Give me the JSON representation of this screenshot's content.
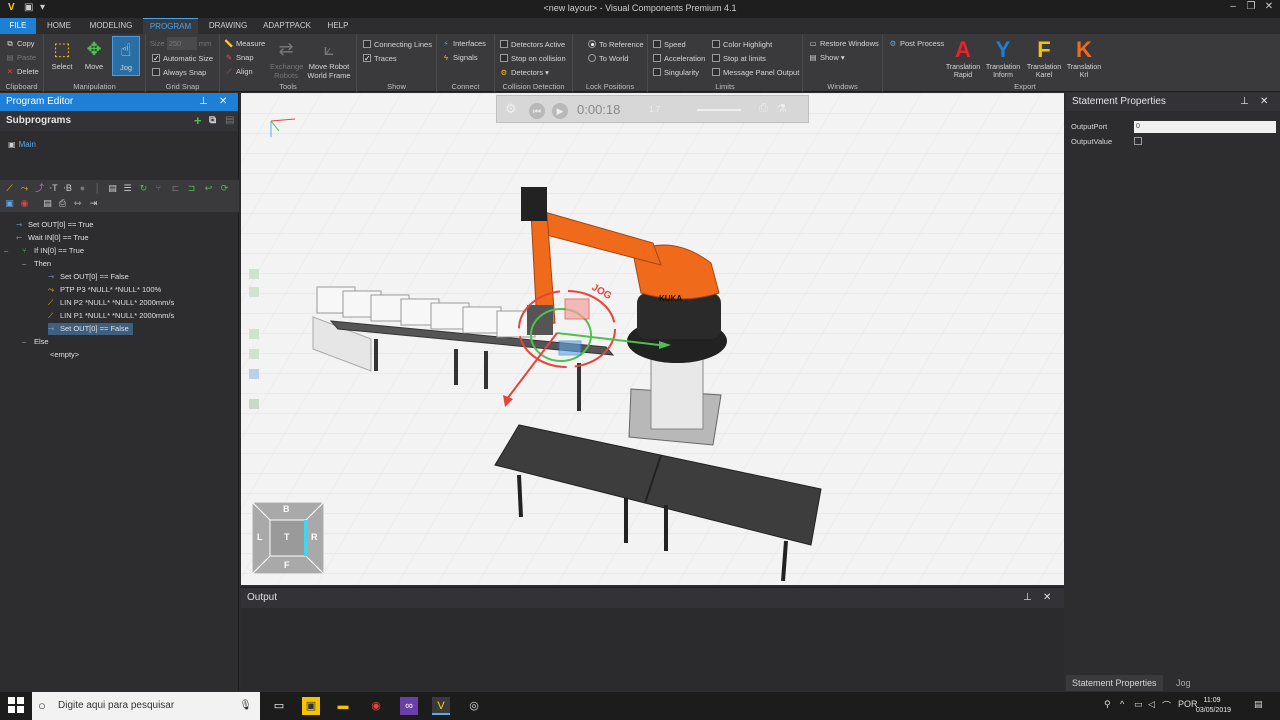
{
  "window": {
    "title": "<new layout> - Visual Components Premium 4.1"
  },
  "ribbon_tabs": [
    "FILE",
    "HOME",
    "MODELING",
    "PROGRAM",
    "DRAWING",
    "ADAPTPACK",
    "HELP"
  ],
  "clipboard": {
    "copy": "Copy",
    "paste": "Paste",
    "delete": "Delete",
    "label": "Clipboard"
  },
  "manipulation": {
    "select": "Select",
    "move": "Move",
    "jog": "Jog",
    "label": "Manipulation"
  },
  "grid_snap": {
    "size_label": "Size",
    "size_value": "250",
    "size_unit": "mm",
    "automatic_size": "Automatic Size",
    "always_snap": "Always Snap",
    "label": "Grid Snap"
  },
  "tools": {
    "measure": "Measure",
    "snap": "Snap",
    "align": "Align",
    "exchange": "Exchange Robots",
    "move_robot": "Move Robot World Frame",
    "label": "Tools"
  },
  "show": {
    "connecting_lines": "Connecting Lines",
    "traces": "Traces",
    "label": "Show"
  },
  "connect": {
    "interfaces": "Interfaces",
    "signals": "Signals",
    "label": "Connect"
  },
  "collision": {
    "detectors_active": "Detectors Active",
    "stop_on_collision": "Stop on collision",
    "detectors": "Detectors ▾",
    "label": "Collision Detection"
  },
  "lock": {
    "to_reference": "To Reference",
    "to_world": "To World",
    "label": "Lock Positions"
  },
  "limits": {
    "speed": "Speed",
    "acceleration": "Acceleration",
    "singularity": "Singularity",
    "color_highlight": "Color Highlight",
    "stop_at_limits": "Stop at limits",
    "message_panel": "Message Panel Output",
    "label": "Limits"
  },
  "windows": {
    "restore": "Restore Windows",
    "show": "Show ▾",
    "post_process": "Post Process",
    "label": "Windows"
  },
  "export": {
    "label": "Export",
    "items": [
      {
        "letter": "A",
        "line1": "Translation",
        "line2": "Rapid",
        "color": "#e8232a"
      },
      {
        "letter": "Y",
        "line1": "Translation",
        "line2": "Inform",
        "color": "#1e7fd6"
      },
      {
        "letter": "F",
        "line1": "Translation",
        "line2": "Karel",
        "color": "#f5c400"
      },
      {
        "letter": "K",
        "line1": "Translation",
        "line2": "Krl",
        "color": "#f06a1c"
      }
    ]
  },
  "program_editor": {
    "title": "Program Editor",
    "subprograms_label": "Subprograms",
    "main_routine": "Main",
    "statements": [
      {
        "text": "Set OUT[0] == True",
        "indent": 0,
        "icon": "set"
      },
      {
        "text": "Wait IN[0] == True",
        "indent": 0,
        "icon": "wait"
      },
      {
        "text": "If IN[0] == True",
        "indent": 0,
        "icon": "if"
      },
      {
        "text": "Then",
        "indent": 1,
        "icon": "branch"
      },
      {
        "text": "Set OUT[0] == False",
        "indent": 2,
        "icon": "set"
      },
      {
        "text": "PTP P3 *NULL* *NULL* 100%",
        "indent": 2,
        "icon": "ptp"
      },
      {
        "text": "LIN P2 *NULL* *NULL* 2000mm/s",
        "indent": 2,
        "icon": "lin"
      },
      {
        "text": "LIN P1 *NULL* *NULL* 2000mm/s",
        "indent": 2,
        "icon": "lin"
      },
      {
        "text": "Set OUT[0] == False",
        "indent": 2,
        "icon": "set",
        "selected": true
      },
      {
        "text": "Else",
        "indent": 1,
        "icon": "branch"
      },
      {
        "text": "<empty>",
        "indent": 2,
        "icon": "none"
      }
    ]
  },
  "simulation": {
    "time": "0:00:18",
    "speed": "1.7"
  },
  "scene": {
    "jog_label": "JOG",
    "robot_brand": "KUKA"
  },
  "view_cube": {
    "top": "B",
    "left": "L",
    "center": "T",
    "right": "R",
    "bottom": "F"
  },
  "output": {
    "title": "Output"
  },
  "statement_properties": {
    "title": "Statement Properties",
    "output_port_label": "OutputPort",
    "output_port_value": "0",
    "output_value_label": "OutputValue",
    "tabs": [
      "Statement Properties",
      "Jog"
    ]
  },
  "taskbar": {
    "search_placeholder": "Digite aqui para pesquisar",
    "language": "POR",
    "time": "11:09",
    "date": "03/05/2019"
  }
}
